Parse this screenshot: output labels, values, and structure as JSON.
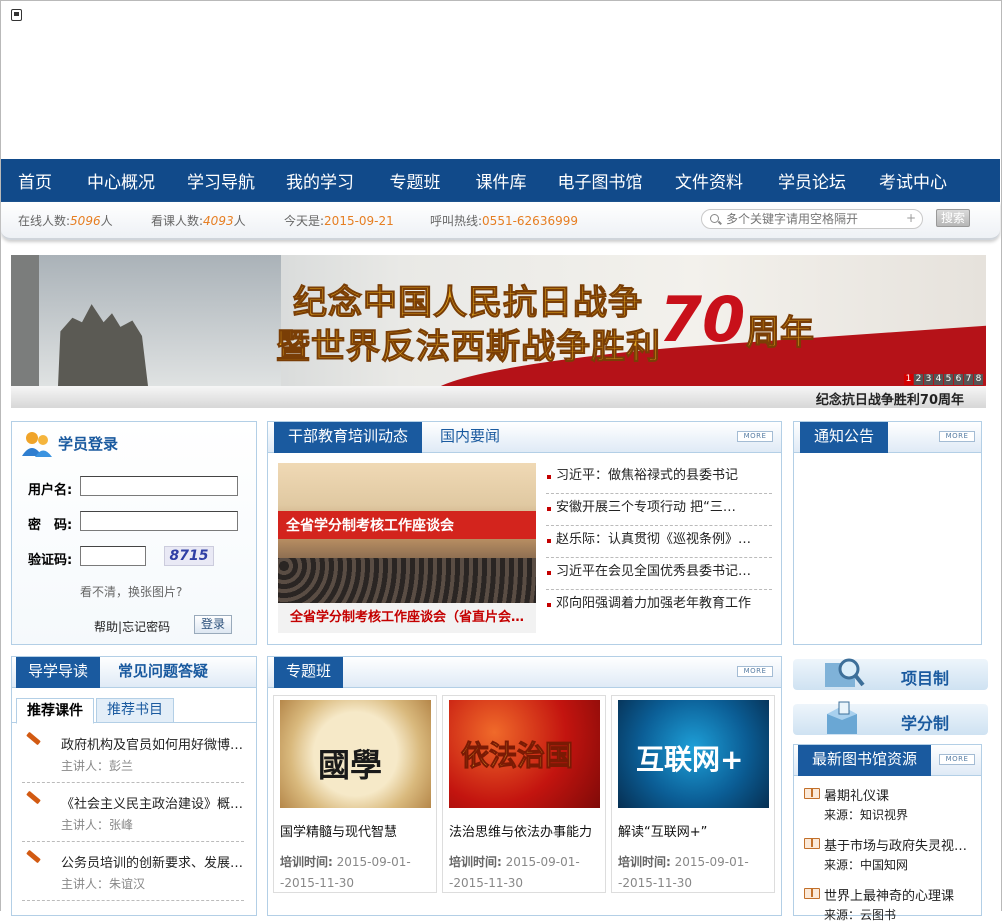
{
  "nav": [
    "首页",
    "中心概况",
    "学习导航",
    "我的学习",
    "专题班",
    "课件库",
    "电子图书馆",
    "文件资料",
    "学员论坛",
    "考试中心"
  ],
  "status": {
    "online_label": "在线人数:",
    "online_value": "5096",
    "online_unit": "人",
    "watch_label": "看课人数:",
    "watch_value": "4093",
    "watch_unit": "人",
    "today_label": "今天是:",
    "today_value": "2015-09-21",
    "hotline_label": "呼叫热线:",
    "hotline_value": "0551-62636999"
  },
  "search": {
    "placeholder": "多个关键字请用空格隔开",
    "button": "搜索"
  },
  "banner": {
    "line1": "纪念中国人民抗日战争",
    "line2": "暨世界反法西斯战争胜利",
    "num": "70",
    "suffix": "周年",
    "caption": "纪念抗日战争胜利70周年",
    "pages": [
      "1",
      "2",
      "3",
      "4",
      "5",
      "6",
      "7",
      "8"
    ],
    "active_page": 1
  },
  "login": {
    "title": "学员登录",
    "username_label": "用户名:",
    "password_label": "密　码:",
    "captcha_label": "验证码:",
    "captcha_text": "8715",
    "refresh_text": "看不清，换张图片?",
    "help": "帮助",
    "sep": "|",
    "forgot": "忘记密码",
    "button": "登录"
  },
  "news": {
    "tab_active": "干部教育培训动态",
    "tab_other": "国内要闻",
    "more": "MORE",
    "photo_banner": "全省学分制考核工作座谈会",
    "photo_caption": "全省学分制考核工作座谈会（省直片会…",
    "items": [
      "习近平：做焦裕禄式的县委书记",
      "安徽开展三个专项行动 把“三…",
      "赵乐际：认真贯彻《巡视条例》…",
      "习近平在会见全国优秀县委书记…",
      "邓向阳强调着力加强老年教育工作"
    ]
  },
  "notice": {
    "title": "通知公告",
    "more": "MORE"
  },
  "guide": {
    "tab_active": "导学导读",
    "tab_other": "常见问题答疑",
    "subtab_active": "推荐课件",
    "subtab_other": "推荐书目",
    "courses": [
      {
        "title": "政府机构及官员如何用好微博…",
        "speaker": "主讲人：彭兰"
      },
      {
        "title": "《社会主义民主政治建设》概…",
        "speaker": "主讲人：张峰"
      },
      {
        "title": "公务员培训的创新要求、发展…",
        "speaker": "主讲人：朱谊汉"
      }
    ]
  },
  "special": {
    "title": "专题班",
    "more": "MORE",
    "time_label": "培训时间:",
    "cards": [
      {
        "img_text": "國學",
        "title": "国学精髓与现代智慧",
        "time": "2015-09-01--2015-11-30"
      },
      {
        "img_text": "依法治国",
        "title": "法治思维与依法办事能力",
        "time": "2015-09-01--2015-11-30"
      },
      {
        "img_text": "互联网+",
        "title": "解读“互联网+”",
        "time": "2015-09-01--2015-11-30"
      }
    ]
  },
  "side": {
    "btn1": "项目制",
    "btn2": "学分制"
  },
  "library": {
    "title": "最新图书馆资源",
    "more": "MORE",
    "items": [
      {
        "title": "暑期礼仪课",
        "source": "来源：知识视界"
      },
      {
        "title": "基于市场与政府失灵视…",
        "source": "来源：中国知网"
      },
      {
        "title": "世界上最神奇的心理课",
        "source": "来源：云图书"
      }
    ]
  },
  "colors": {
    "nav_bg": "#114a8a",
    "accent_blue": "#1a5a9f",
    "orange": "#e67e22",
    "red": "#c40000"
  }
}
